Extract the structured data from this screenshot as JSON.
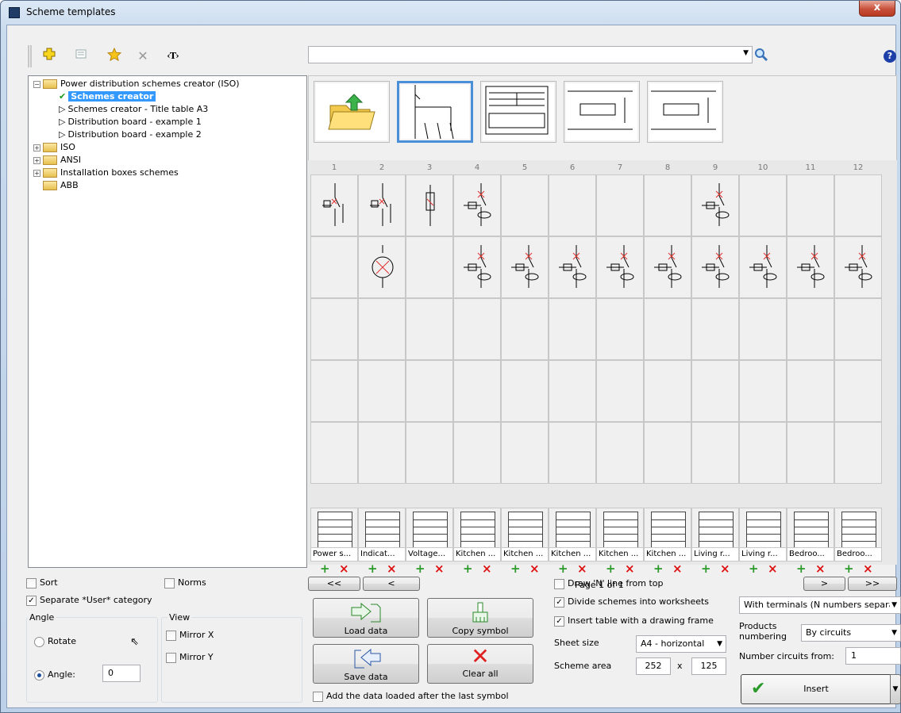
{
  "window": {
    "title": "Scheme templates",
    "close": "x"
  },
  "toolbar": {
    "text_tool": "‹T›",
    "help": "?"
  },
  "tree": {
    "items": [
      {
        "label": "Power distribution schemes creator (ISO)",
        "expander": "−"
      },
      {
        "label": "Schemes creator"
      },
      {
        "label": "Schemes creator - Title table A3"
      },
      {
        "label": "Distribution board - example 1"
      },
      {
        "label": "Distribution board - example 2"
      },
      {
        "label": "ISO",
        "expander": "+"
      },
      {
        "label": "ANSI",
        "expander": "+"
      },
      {
        "label": "Installation boxes schemes",
        "expander": "+"
      },
      {
        "label": "ABB"
      }
    ]
  },
  "grid": {
    "columns": [
      "1",
      "2",
      "3",
      "4",
      "5",
      "6",
      "7",
      "8",
      "9",
      "10",
      "11",
      "12"
    ],
    "circuit_labels": [
      "Power s...",
      "Indicat...",
      "Voltage...",
      "Kitchen ...",
      "Kitchen ...",
      "Kitchen ...",
      "Kitchen ...",
      "Kitchen ...",
      "Living r...",
      "Living r...",
      "Bedroo...",
      "Bedroo..."
    ],
    "plus": "+",
    "minus": "×"
  },
  "nav": {
    "first": "<<",
    "prev": "<",
    "page": "Page 1 of 1",
    "next": ">",
    "last": ">>"
  },
  "options": {
    "sort": "Sort",
    "norms": "Norms",
    "separate_user": "Separate *User* category",
    "angle_group": "Angle",
    "rotate": "Rotate",
    "angle_label": "Angle:",
    "angle_value": "0",
    "view_group": "View",
    "mirror_x": "Mirror X",
    "mirror_y": "Mirror Y"
  },
  "actions": {
    "load": "Load data",
    "copy": "Copy symbol",
    "save": "Save data",
    "clear": "Clear all",
    "add_after": "Add the data loaded after the last symbol"
  },
  "settings": {
    "draw_n": "Draw 'N' line from top",
    "divide": "Divide schemes into worksheets",
    "insert_table": "Insert table with a drawing frame",
    "sheet_size_label": "Sheet size",
    "sheet_size": "A4 - horizontal",
    "scheme_area_label": "Scheme area",
    "area_w": "252",
    "x": "x",
    "area_h": "125",
    "terminals": "With terminals (N numbers separa",
    "numbering_label_1": "Products",
    "numbering_label_2": "numbering",
    "numbering": "By circuits",
    "circuits_from_label": "Number circuits from:",
    "circuits_from": "1",
    "insert": "Insert"
  }
}
